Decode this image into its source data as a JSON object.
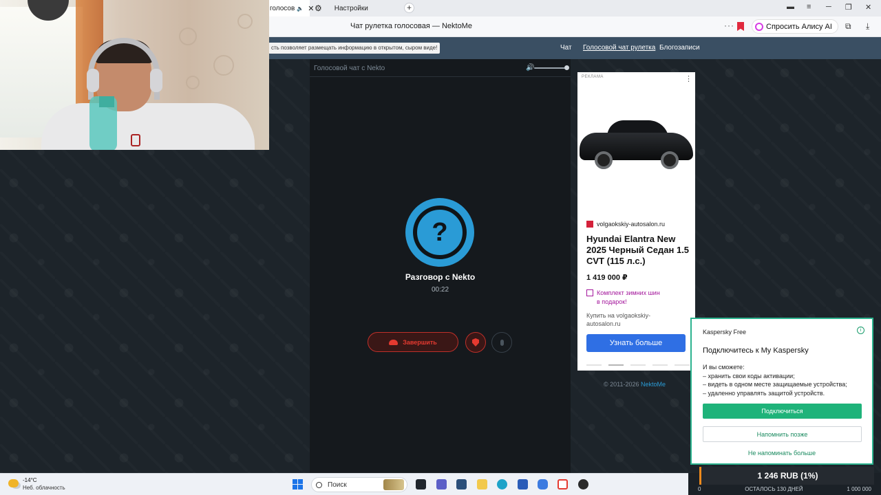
{
  "browser": {
    "tabs": [
      {
        "label": "голосов",
        "active": true
      },
      {
        "label": "Настройки",
        "active": false
      }
    ],
    "page_title": "Чат рулетка голосовая — NektoMe",
    "alice_button": "Спросить Алису AI",
    "menu_dots": "···"
  },
  "site": {
    "notice": "сть позволяет размещать информацию в открытом, сыром виде!",
    "nav": [
      {
        "label": "Чат",
        "active": false
      },
      {
        "label": "Голосовой чат рулетка",
        "active": true
      },
      {
        "label": "Блогозаписи",
        "active": false
      }
    ]
  },
  "chat": {
    "header_title": "Голосовой чат с Nekto",
    "avatar_glyph": "?",
    "conversation_title": "Разговор с Nekto",
    "timer": "00:22",
    "end_button": "Завершить"
  },
  "ad": {
    "label": "РЕКЛАМА",
    "menu_glyph": "⋮",
    "domain": "volgaokskiy-autosalon.ru",
    "title": "Hyundai Elantra New 2025 Черный Седан 1.5 CVT (115 л.с.)",
    "price": "1 419 000 ₽",
    "gift_text_line1": "Комплект зимних шин",
    "gift_text_line2": "в подарок!",
    "buy_text": "Купить на volgaokskiy-autosalon.ru",
    "cta": "Узнать больше"
  },
  "footer": {
    "copyright_prefix": "© 2011-2026 ",
    "copyright_link": "NektoMe"
  },
  "kaspersky": {
    "brand": "Kaspersky Free",
    "info_glyph": "i",
    "heading": "Подключитесь к My Kaspersky",
    "intro": "И вы сможете:",
    "bullets": [
      "– хранить свои коды активации;",
      "– видеть в одном месте защищаемые устройства;",
      "– удаленно управлять защитой устройств."
    ],
    "connect_button": "Подключиться",
    "remind_button": "Напомнить позже",
    "never_button": "Не напоминать больше"
  },
  "balance": {
    "amount": "1 246 RUB (1%)",
    "left": "0",
    "center": "ОСТАЛОСЬ 130 ДНЕЙ",
    "right": "1 000 000"
  },
  "taskbar": {
    "temperature": "-14°C",
    "weather": "Неб. облачность",
    "search_placeholder": "Поиск"
  },
  "colors": {
    "accent_blue": "#2a9bd6",
    "end_red": "#e53a30",
    "kaspersky_green": "#1fb37a",
    "nav_bg": "#3a4f63"
  }
}
